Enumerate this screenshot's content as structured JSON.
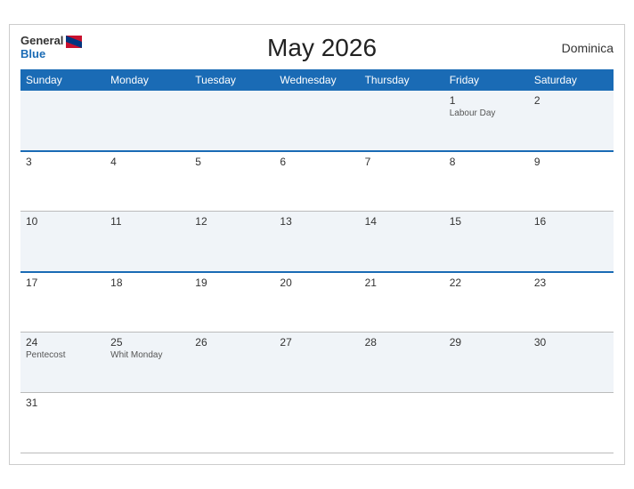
{
  "header": {
    "logo_general": "General",
    "logo_blue": "Blue",
    "title": "May 2026",
    "country": "Dominica"
  },
  "days_of_week": [
    "Sunday",
    "Monday",
    "Tuesday",
    "Wednesday",
    "Thursday",
    "Friday",
    "Saturday"
  ],
  "weeks": [
    [
      {
        "day": "",
        "event": ""
      },
      {
        "day": "",
        "event": ""
      },
      {
        "day": "",
        "event": ""
      },
      {
        "day": "",
        "event": ""
      },
      {
        "day": "",
        "event": ""
      },
      {
        "day": "1",
        "event": "Labour Day"
      },
      {
        "day": "2",
        "event": ""
      }
    ],
    [
      {
        "day": "3",
        "event": ""
      },
      {
        "day": "4",
        "event": ""
      },
      {
        "day": "5",
        "event": ""
      },
      {
        "day": "6",
        "event": ""
      },
      {
        "day": "7",
        "event": ""
      },
      {
        "day": "8",
        "event": ""
      },
      {
        "day": "9",
        "event": ""
      }
    ],
    [
      {
        "day": "10",
        "event": ""
      },
      {
        "day": "11",
        "event": ""
      },
      {
        "day": "12",
        "event": ""
      },
      {
        "day": "13",
        "event": ""
      },
      {
        "day": "14",
        "event": ""
      },
      {
        "day": "15",
        "event": ""
      },
      {
        "day": "16",
        "event": ""
      }
    ],
    [
      {
        "day": "17",
        "event": ""
      },
      {
        "day": "18",
        "event": ""
      },
      {
        "day": "19",
        "event": ""
      },
      {
        "day": "20",
        "event": ""
      },
      {
        "day": "21",
        "event": ""
      },
      {
        "day": "22",
        "event": ""
      },
      {
        "day": "23",
        "event": ""
      }
    ],
    [
      {
        "day": "24",
        "event": "Pentecost"
      },
      {
        "day": "25",
        "event": "Whit Monday"
      },
      {
        "day": "26",
        "event": ""
      },
      {
        "day": "27",
        "event": ""
      },
      {
        "day": "28",
        "event": ""
      },
      {
        "day": "29",
        "event": ""
      },
      {
        "day": "30",
        "event": ""
      }
    ],
    [
      {
        "day": "31",
        "event": ""
      },
      {
        "day": "",
        "event": ""
      },
      {
        "day": "",
        "event": ""
      },
      {
        "day": "",
        "event": ""
      },
      {
        "day": "",
        "event": ""
      },
      {
        "day": "",
        "event": ""
      },
      {
        "day": "",
        "event": ""
      }
    ]
  ],
  "highlighted_rows": [
    1,
    3
  ],
  "colors": {
    "header_bg": "#1a6bb5",
    "accent": "#1a6bb5"
  }
}
